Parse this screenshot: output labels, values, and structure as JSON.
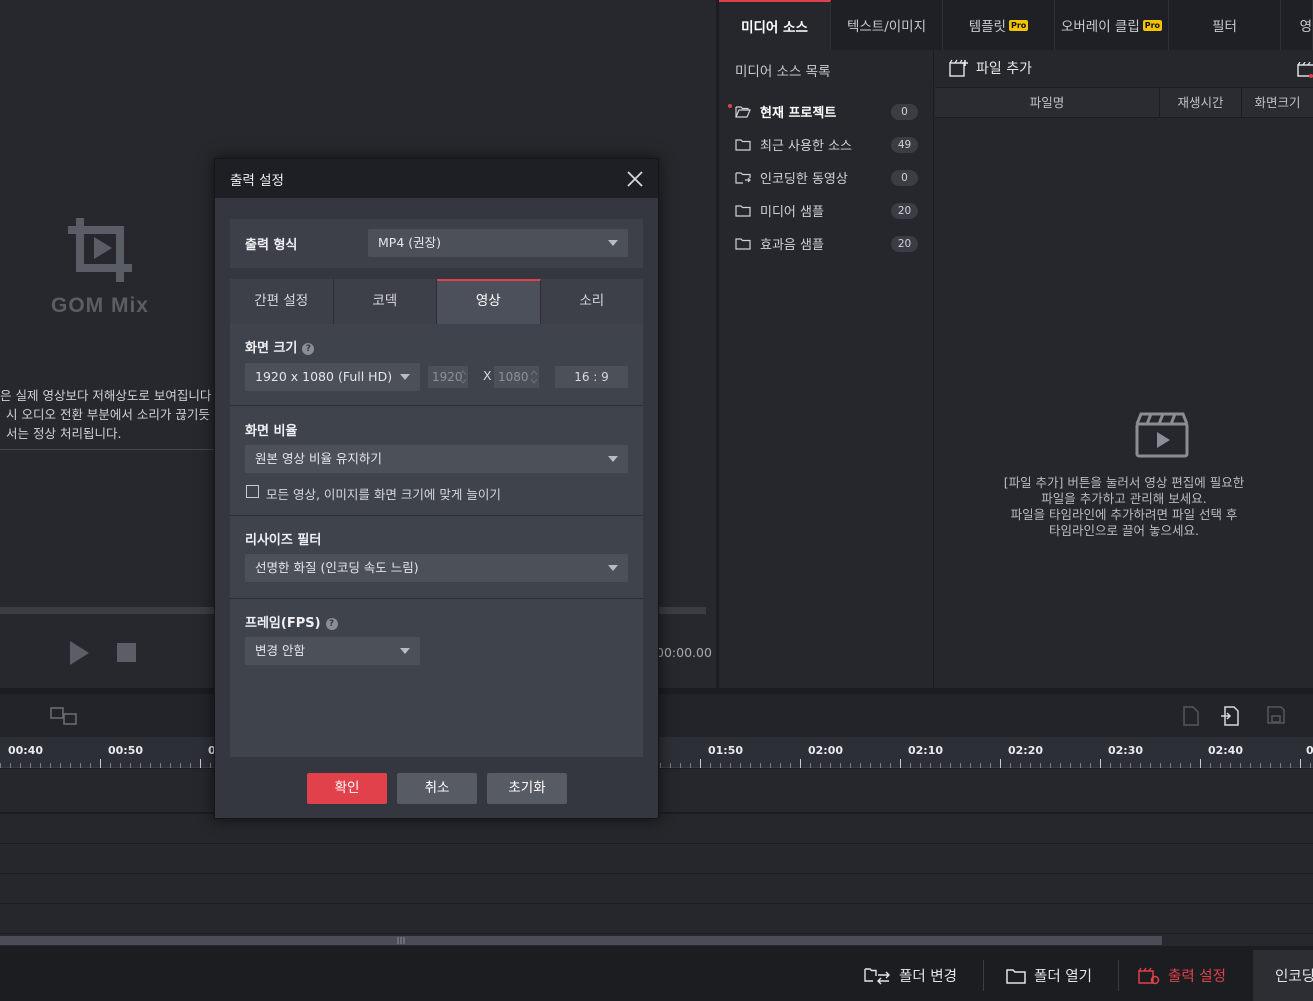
{
  "preview": {
    "logo_text": "GOM Mix",
    "notice_lines": [
      "은 실제 영상보다 저해상도로 보여집니다",
      "시 오디오 전환 부분에서 소리가 끊기듯",
      "서는 정상 처리됩니다."
    ],
    "time": "00:00.00"
  },
  "right_panel": {
    "tabs": [
      {
        "label": "미디어 소스",
        "pro": false
      },
      {
        "label": "텍스트/이미지",
        "pro": false
      },
      {
        "label": "템플릿",
        "pro": true
      },
      {
        "label": "오버레이 클립",
        "pro": true
      },
      {
        "label": "필터",
        "pro": false
      },
      {
        "label": "영",
        "pro": false
      }
    ],
    "pro_badge": "Pro",
    "source_list_title": "미디어 소스 목록",
    "sources": [
      {
        "label": "현재 프로젝트",
        "count": "0"
      },
      {
        "label": "최근 사용한 소스",
        "count": "49"
      },
      {
        "label": "인코딩한 동영상",
        "count": "0"
      },
      {
        "label": "미디어 샘플",
        "count": "20"
      },
      {
        "label": "효과음 샘플",
        "count": "20"
      }
    ],
    "add_file_label": "파일 추가",
    "columns": [
      "파일명",
      "재생시간",
      "화면크기"
    ],
    "empty_message_lines": [
      "[파일 추가] 버튼을 눌러서 영상 편집에 필요한",
      "파일을 추가하고 관리해 보세요.",
      "파일을 타임라인에 추가하려면 파일 선택 후",
      "타임라인으로 끌어 놓으세요."
    ]
  },
  "timeline": {
    "ticks": [
      "00:40",
      "00:50",
      "0",
      "01:50",
      "02:00",
      "02:10",
      "02:20",
      "02:30",
      "02:40",
      "0"
    ]
  },
  "bottom_bar": {
    "change_folder": "폴더 변경",
    "open_folder": "폴더 열기",
    "output_settings": "출력 설정",
    "encode": "인코딩",
    "accent_color": "#e0414b"
  },
  "dialog": {
    "title": "출력 설정",
    "format_label": "출력 형식",
    "format_value": "MP4 (권장)",
    "tabs": [
      "간편 설정",
      "코덱",
      "영상",
      "소리"
    ],
    "active_tab": "영상",
    "screen_size_label": "화면 크기",
    "screen_size_value": "1920 x 1080 (Full HD)",
    "width": "1920",
    "height": "1080",
    "x_sep": "X",
    "ratio_readout": "16 : 9",
    "aspect_label": "화면 비율",
    "aspect_value": "원본 영상 비율 유지하기",
    "stretch_checkbox_label": "모든 영상, 이미지를 화면 크기에 맞게 늘이기",
    "resize_filter_label": "리사이즈 필터",
    "resize_filter_value": "선명한 화질 (인코딩 속도 느림)",
    "fps_label": "프레임(FPS)",
    "fps_value": "변경 안함",
    "help_glyph": "?",
    "confirm": "확인",
    "cancel": "취소",
    "reset": "초기화"
  }
}
